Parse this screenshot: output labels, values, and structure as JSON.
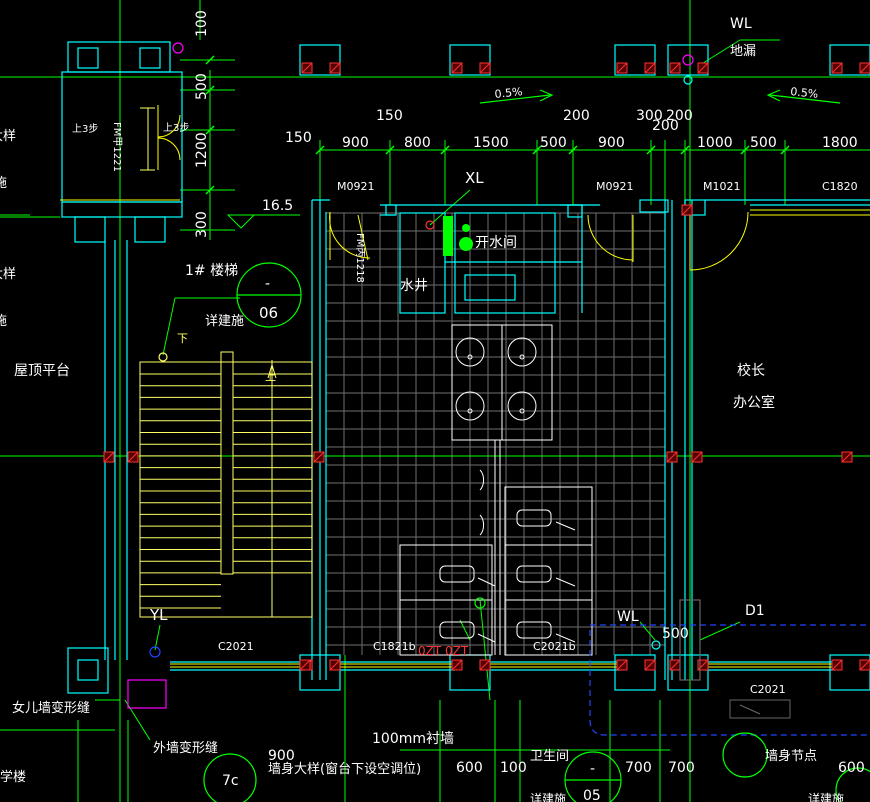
{
  "colors": {
    "background": "#000000",
    "wall": "#00ffff",
    "grid": "#00ff00",
    "dim": "#00ff00",
    "fixture": "#ffffff",
    "stair": "#ffff66",
    "column": "#ff3333",
    "window": "#ffff00",
    "tile": "#6f6f6f",
    "blue_outline": "#2244ff",
    "magenta": "#ff00ff",
    "green_fill": "#00ff00"
  },
  "labels": {
    "wl_top": "WL",
    "floor_drain": "地漏",
    "slope_left": "0.5%",
    "slope_right": "0.5%",
    "elev_165": "16.5",
    "xl": "XL",
    "open_room": "开水间",
    "water_well": "水井",
    "fm_left": "FM甲1221",
    "fm_right": "FM丙1218",
    "up_step_left": "上3步",
    "up_step_right": "上3步",
    "stair_name": "1# 楼梯",
    "stair_detail": "详建施",
    "detail_top": "-",
    "detail_bottom": "06",
    "down": "下",
    "up": "上",
    "roof_platform": "屋顶平台",
    "principal_1": "校长",
    "principal_2": "办公室",
    "m0921_left": "M0921",
    "m0921_right": "M0921",
    "m1021": "M1021",
    "c1820": "C1820",
    "yl": "YL",
    "c2021_left": "C2021",
    "c1821b": "C1821b",
    "c2021b": "C2021b",
    "wl_bottom": "WL",
    "d1": "D1",
    "c2021_right": "C2021",
    "dim_500_bottom": "500",
    "parapet_joint": "女儿墙变形缝",
    "outer_wall_joint": "外墙变形缝",
    "lining_wall": "100mm衬墙",
    "window_detail": "墙身大样(窗台下设空调位)",
    "toilet": "卫生间",
    "wall_node": "墙身节点",
    "school_building": "学楼",
    "left_edge_1": "大样",
    "left_edge_2": "施",
    "left_edge_3": "大样",
    "left_edge_4": "施",
    "circle_7c": "7c",
    "circle_05": "05",
    "circle_dash": "-",
    "detail_bottom_text_1": "详建施",
    "detail_bottom_text_2": "详建施",
    "circle_annot": "0ZT 0ZT",
    "plain_300": "300",
    "plain_200": "200"
  },
  "dimensions": {
    "top_row": [
      "150",
      "200",
      "300",
      "200"
    ],
    "mid_row": [
      "150",
      "900",
      "800",
      "1500",
      "500",
      "900",
      "1000",
      "500",
      "1800"
    ],
    "extra_200": "200",
    "vertical": [
      "100",
      "500",
      "1200",
      "300"
    ],
    "bottom_row": [
      "600",
      "100",
      "700",
      "700",
      "600"
    ],
    "bottom_left_900": "900"
  }
}
